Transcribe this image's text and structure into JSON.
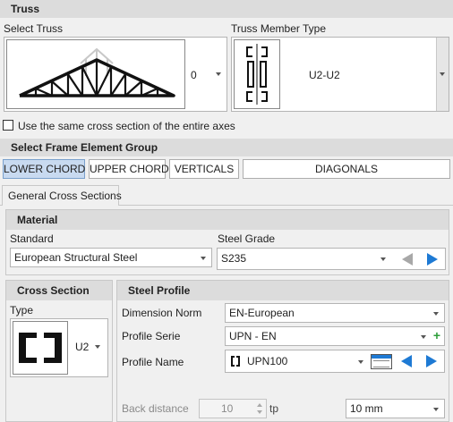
{
  "truss": {
    "title": "Truss",
    "select_truss_label": "Select Truss",
    "select_truss_value": "0",
    "member_type_label": "Truss Member Type",
    "member_type_value": "U2-U2"
  },
  "same_section_checkbox": {
    "label": "Use the same cross section of the entire axes",
    "checked": false
  },
  "frame_group": {
    "title": "Select Frame Element Group",
    "buttons": [
      {
        "label": "LOWER CHORD",
        "active": true
      },
      {
        "label": "UPPER CHORD",
        "active": false
      },
      {
        "label": "VERTICALS",
        "active": false
      },
      {
        "label": "DIAGONALS",
        "active": false
      }
    ]
  },
  "tabs": [
    {
      "label": "General Cross Sections",
      "active": true
    }
  ],
  "material": {
    "title": "Material",
    "standard_label": "Standard",
    "standard_value": "European Structural Steel",
    "grade_label": "Steel Grade",
    "grade_value": "S235"
  },
  "cross_section": {
    "title": "Cross Section",
    "type_label": "Type",
    "type_value": "U2"
  },
  "steel_profile": {
    "title": "Steel Profile",
    "dimension_norm_label": "Dimension Norm",
    "dimension_norm_value": "EN-European",
    "profile_serie_label": "Profile Serie",
    "profile_serie_value": "UPN - EN",
    "profile_name_label": "Profile Name",
    "profile_name_value": "UPN100",
    "back_distance_label": "Back distance",
    "back_distance_value": "10",
    "back_distance_unit": "tp",
    "back_distance_select": "10 mm"
  },
  "colors": {
    "accent": "#1e7ad4",
    "add_green": "#2e9e3a",
    "header_gray": "#dcdcdc",
    "active_button": "#c8daf0"
  }
}
